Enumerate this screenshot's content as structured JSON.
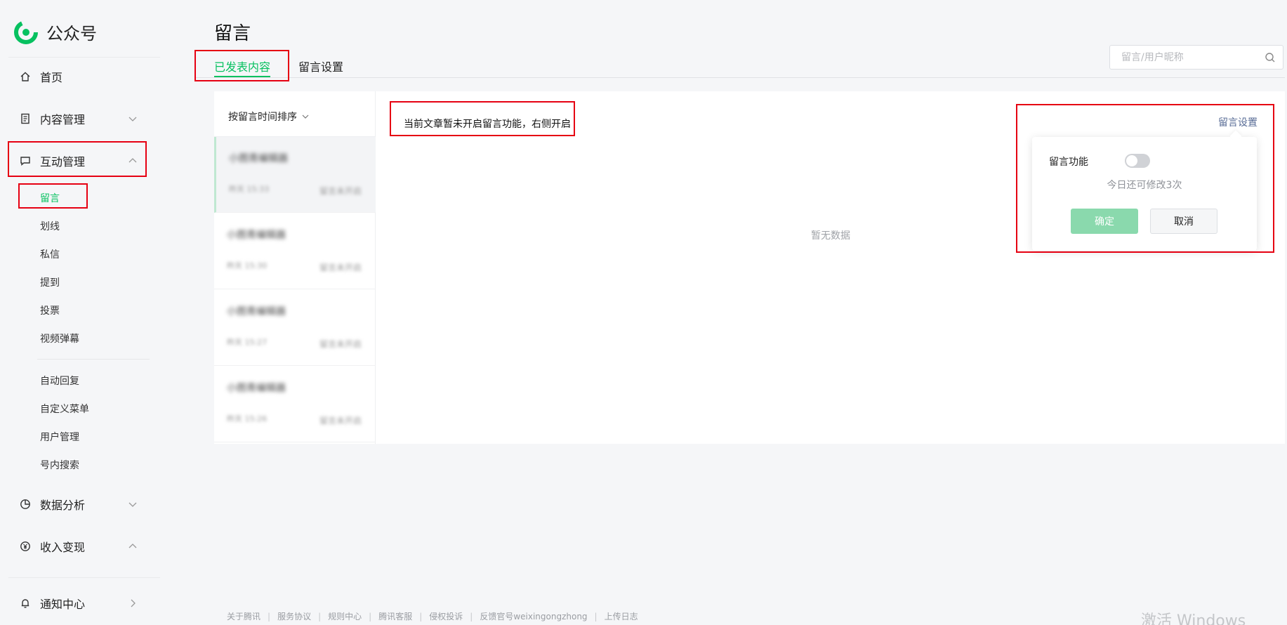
{
  "brand": {
    "name": "公众号",
    "color": "#07c160"
  },
  "sidebar": {
    "home": {
      "label": "首页",
      "icon": "home-icon"
    },
    "content": {
      "label": "内容管理",
      "icon": "document-icon"
    },
    "interaction": {
      "label": "互动管理",
      "icon": "comment-icon",
      "items": [
        "留言",
        "划线",
        "私信",
        "提到",
        "投票",
        "视频弹幕"
      ]
    },
    "tools": [
      "自动回复",
      "自定义菜单",
      "用户管理",
      "号内搜索"
    ],
    "analytics": {
      "label": "数据分析",
      "icon": "pie-chart-icon"
    },
    "revenue": {
      "label": "收入变现",
      "icon": "yen-icon"
    },
    "notifications": {
      "label": "通知中心",
      "icon": "bell-icon"
    }
  },
  "header": {
    "title": "留言",
    "tabs": [
      "已发表内容",
      "留言设置"
    ]
  },
  "search": {
    "placeholder": "留言/用户昵称"
  },
  "list": {
    "sort_label": "按留言时间排序",
    "articles": [
      {
        "title": "小图青编辑器",
        "meta": "昨天 15:33",
        "status": "留言未开启"
      },
      {
        "title": "小图青编辑器",
        "meta": "昨天 15:30",
        "status": "留言未开启"
      },
      {
        "title": "小图青编辑器",
        "meta": "昨天 15:27",
        "status": "留言未开启"
      },
      {
        "title": "小图青编辑器",
        "meta": "昨天 15:26",
        "status": "留言未开启"
      }
    ]
  },
  "main": {
    "notice": "当前文章暂未开启留言功能，右侧开启",
    "empty": "暂无数据",
    "settings_link": "留言设置"
  },
  "popover": {
    "label": "留言功能",
    "toggle_on": false,
    "hint": "今日还可修改3次",
    "confirm": "确定",
    "cancel": "取消"
  },
  "footer": {
    "links": [
      "关于腾讯",
      "服务协议",
      "规则中心",
      "腾讯客服",
      "侵权投诉",
      "反馈官号weixingongzhong",
      "上传日志"
    ]
  },
  "watermark": "激活 Windows"
}
